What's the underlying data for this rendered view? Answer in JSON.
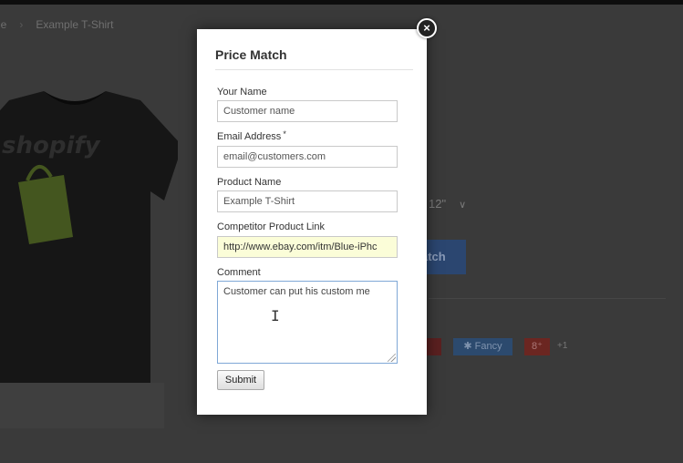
{
  "background": {
    "breadcrumb": {
      "prev": "ge",
      "separator": "›",
      "current": "Example T-Shirt"
    },
    "product_image": {
      "brand_text": "shopify"
    },
    "size_select": {
      "value": "12\"",
      "chevron": "chevron-down-icon"
    },
    "match_button_label": "atch",
    "share": {
      "fancy_label": "Fancy",
      "fancy_icon": "star-icon",
      "gplus_label": "8⁺",
      "gplus_count": "+1"
    }
  },
  "modal": {
    "title": "Price Match",
    "close_glyph": "×",
    "fields": {
      "name": {
        "label": "Your Name",
        "value": "Customer name"
      },
      "email": {
        "label": "Email Address",
        "required_mark": "*",
        "value": "email@customers.com"
      },
      "product": {
        "label": "Product Name",
        "value": "Example T-Shirt"
      },
      "competitor_link": {
        "label": "Competitor Product Link",
        "value": "http://www.ebay.com/itm/Blue-iPhc"
      },
      "comment": {
        "label": "Comment",
        "value": "Customer can put his custom me"
      }
    },
    "submit_label": "Submit"
  },
  "colors": {
    "overlay": "#3a3a3a",
    "modal_bg": "#ffffff",
    "highlight_field": "#fbfdd8",
    "fancy_blue": "#2c4a6e",
    "gplus_red": "#6b2621"
  }
}
